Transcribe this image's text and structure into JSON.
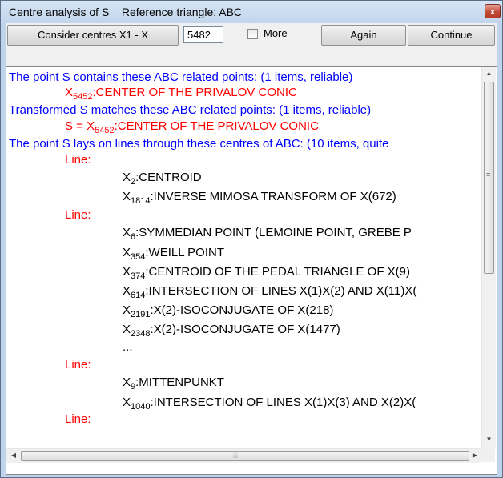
{
  "window": {
    "title": "Centre analysis of S    Reference triangle: ABC",
    "close_glyph": "x"
  },
  "toolbar": {
    "consider_label": "Consider centres X1 - X",
    "centres_value": "5482",
    "more_label": "More",
    "more_checked": false,
    "again_label": "Again",
    "continue_label": "Continue"
  },
  "results": {
    "contains_header": "The point S contains these ABC related points: (1 items, reliable)",
    "contains_item": {
      "prefix": "X",
      "sub": "5452",
      "text": ":CENTER OF THE PRIVALOV CONIC"
    },
    "matches_header": "Transformed S matches these ABC related points: (1 items, reliable)",
    "matches_item": {
      "prefix": "S = X",
      "sub": "5452",
      "text": ":CENTER OF THE PRIVALOV CONIC"
    },
    "lines_header": "The point S lays on lines through these centres of ABC: (10 items, quite",
    "line_label": "Line:",
    "line1": [
      {
        "sub": "2",
        "text": ":CENTROID"
      },
      {
        "sub": "1814",
        "text": ":INVERSE MIMOSA TRANSFORM OF X(672)"
      }
    ],
    "line2": [
      {
        "sub": "6",
        "text": ":SYMMEDIAN POINT (LEMOINE POINT, GREBE P"
      },
      {
        "sub": "354",
        "text": ":WEILL POINT"
      },
      {
        "sub": "374",
        "text": ":CENTROID OF THE PEDAL TRIANGLE OF X(9)"
      },
      {
        "sub": "614",
        "text": ":INTERSECTION OF LINES X(1)X(2) AND X(11)X("
      },
      {
        "sub": "2191",
        "text": ":X(2)-ISOCONJUGATE OF X(218)"
      },
      {
        "sub": "2348",
        "text": ":X(2)-ISOCONJUGATE OF X(1477)"
      }
    ],
    "ellipsis": "...",
    "line3": [
      {
        "sub": "9",
        "text": ":MITTENPUNKT"
      },
      {
        "sub": "1040",
        "text": ":INTERSECTION OF LINES X(1)X(3) AND X(2)X("
      }
    ],
    "x_prefix": "X"
  },
  "scrollbar": {
    "grip_glyph": "≡",
    "hgrip_glyph": "⦙⦙⦙"
  }
}
